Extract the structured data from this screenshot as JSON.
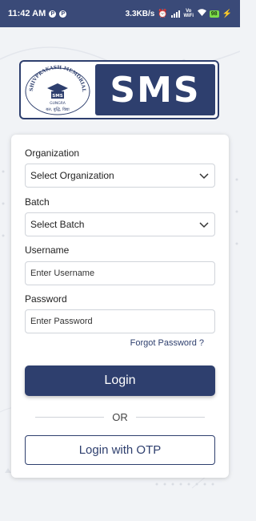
{
  "status_bar": {
    "time": "11:42 AM",
    "app_badges": [
      "P",
      "P"
    ],
    "speed": "3.3KB/s",
    "network_label": "Vo WiFi",
    "battery": "98"
  },
  "logo": {
    "seal_arc_text": "SHIVPRAKASH MEMORIAL SCHOOL",
    "seal_center": "SMS",
    "seal_place": "GUNGRA",
    "seal_motto": "बल, बुद्धि, विद्या",
    "brand": "SMS"
  },
  "form": {
    "organization_label": "Organization",
    "organization_value": "Select Organization",
    "batch_label": "Batch",
    "batch_value": "Select Batch",
    "username_label": "Username",
    "username_placeholder": "Enter Username",
    "password_label": "Password",
    "password_placeholder": "Enter Password",
    "forgot_password": "Forgot Password ?",
    "login_button": "Login",
    "or_text": "OR",
    "otp_button": "Login with OTP"
  },
  "colors": {
    "primary": "#2e3f6e",
    "status_bar": "#3a4a78",
    "background": "#f1f3f6"
  }
}
